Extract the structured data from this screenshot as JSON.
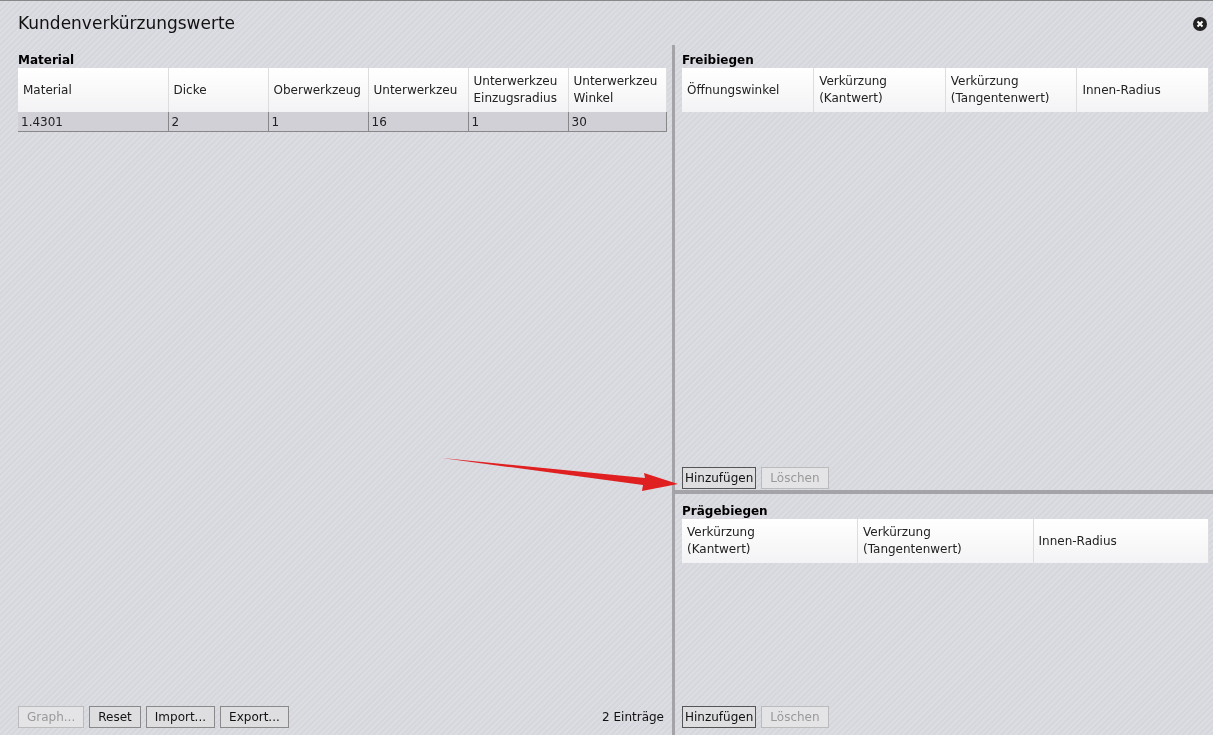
{
  "window": {
    "title": "Kundenverkürzungswerte"
  },
  "material": {
    "title": "Material",
    "columns": [
      "Material",
      "Dicke",
      "Oberwerkzeug",
      "Unterwerkzeu",
      "Unterwerkzeu\nEinzugsradius",
      "Unterwerkzeu\nWinkel"
    ],
    "rows": [
      [
        "1.4301",
        "2",
        "1",
        "16",
        "1",
        "30"
      ]
    ],
    "buttons": [
      {
        "label": "Graph...",
        "disabled": true
      },
      {
        "label": "Reset",
        "disabled": false
      },
      {
        "label": "Import...",
        "disabled": false
      },
      {
        "label": "Export...",
        "disabled": false
      }
    ],
    "count": "2 Einträge"
  },
  "freibiegen": {
    "title": "Freibiegen",
    "columns": [
      "Öffnungswinkel",
      "Verkürzung\n(Kantwert)",
      "Verkürzung\n(Tangentenwert)",
      "Innen-Radius"
    ],
    "buttons": [
      {
        "label": "Hinzufügen",
        "disabled": false
      },
      {
        "label": "Löschen",
        "disabled": true
      }
    ]
  },
  "praegebiegen": {
    "title": "Prägebiegen",
    "columns": [
      "Verkürzung\n(Kantwert)",
      "Verkürzung\n(Tangentenwert)",
      "Innen-Radius"
    ],
    "buttons": [
      {
        "label": "Hinzufügen",
        "disabled": false
      },
      {
        "label": "Löschen",
        "disabled": true
      }
    ]
  }
}
